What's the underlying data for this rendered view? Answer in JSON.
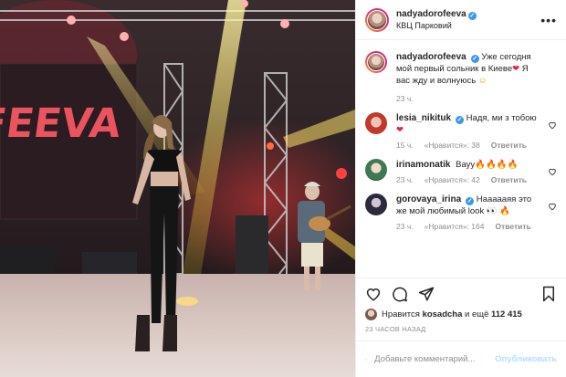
{
  "post": {
    "username": "nadyadorofeeva",
    "verified_mark": "✓",
    "location": "КВЦ Парковий",
    "more_label": "•••",
    "stage_screen_text": "FEEVA"
  },
  "caption": {
    "username": "nadyadorofeeva",
    "text": "Уже сегодня мой первый сольник в Киеве",
    "text_after": "Я вас жду и волнуюсь",
    "emoji_heart": "❤",
    "emoji_face": "☺",
    "time": "23 ч."
  },
  "comments": [
    {
      "username": "lesia_nikituk",
      "verified": true,
      "text": "Надя, ми з тобою",
      "emoji": "❤",
      "time": "15 ч.",
      "likes": "«Нравится»: 38",
      "reply": "Ответить"
    },
    {
      "username": "irinamonatik",
      "verified": false,
      "text": "Вауу",
      "emoji": "🔥🔥🔥🔥",
      "time": "23 ч.",
      "likes": "«Нравится»: 42",
      "reply": "Ответить"
    },
    {
      "username": "gorovaya_irina",
      "verified": true,
      "text": "Наааааяя это же мой любимый look",
      "emoji": "👀 🔥",
      "time": "23 ч.",
      "likes": "«Нравится»: 164",
      "reply": "Ответить"
    }
  ],
  "likes_line": {
    "prefix": "Нравится",
    "user": "kosadcha",
    "middle": "и ещё",
    "count": "112 415"
  },
  "time_ago": "23 ЧАСОВ НАЗАД",
  "add_comment": {
    "placeholder": "Добавьте комментарий...",
    "publish_label": "Опубликовать"
  },
  "icons": {
    "like": "heart-icon",
    "comment": "comment-icon",
    "share": "share-icon",
    "save": "bookmark-icon",
    "emoji": "smiley-icon"
  },
  "colors": {
    "verified": "#3897f0",
    "publish_disabled": "#b2dffc",
    "meta_grey": "#8e8e8e",
    "heart_red": "#e0244a"
  }
}
